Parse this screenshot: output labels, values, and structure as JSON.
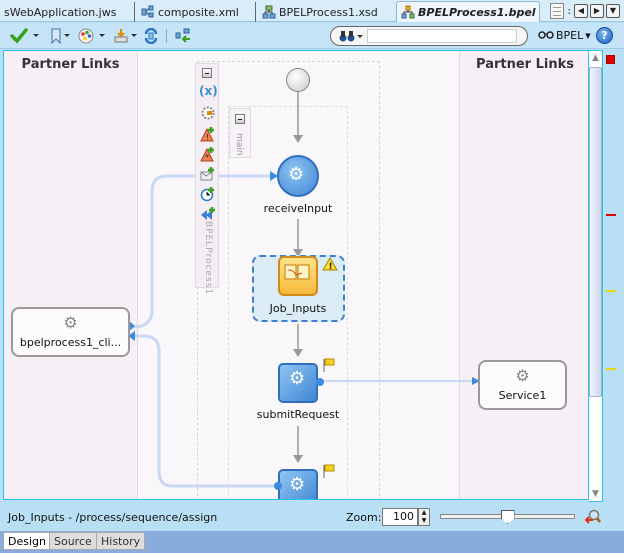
{
  "editor_tabs": [
    {
      "label": "sWebApplication.jws",
      "icon": "jws-icon",
      "active": false
    },
    {
      "label": "composite.xml",
      "icon": "composite-icon",
      "active": false
    },
    {
      "label": "BPELProcess1.xsd",
      "icon": "xsd-icon",
      "active": false
    },
    {
      "label": "BPELProcess1.bpel",
      "icon": "bpel-icon",
      "active": true
    }
  ],
  "tab_nav": {
    "list_label": "document-list",
    "prev": "◀",
    "next": "▶",
    "menu": "▼"
  },
  "toolbar": {
    "search_placeholder": "",
    "bpel_menu_label": "BPEL",
    "help_label": "?"
  },
  "canvas": {
    "left_partner_links_title": "Partner Links",
    "right_partner_links_title": "Partner Links",
    "process_scope_label": "BPELProcess1",
    "main_scope_label": "main",
    "activities": [
      {
        "name": "receiveInput",
        "type": "receive"
      },
      {
        "name": "Job_Inputs",
        "type": "assign",
        "selected": true,
        "warning": true
      },
      {
        "name": "submitRequest",
        "type": "invoke",
        "flag": true
      },
      {
        "name": "",
        "type": "invoke",
        "flag": true
      }
    ],
    "partner_links": [
      {
        "name": "bpelprocess1_cli...",
        "side": "left"
      },
      {
        "name": "Service1",
        "side": "right"
      }
    ]
  },
  "status": {
    "selection_path": "Job_Inputs - /process/sequence/assign",
    "zoom_label": "Zoom:",
    "zoom_value": "100",
    "zoom_slider_fraction": 0.5
  },
  "overview_markers": [
    {
      "color": "#e00000",
      "kind": "error"
    },
    {
      "color": "#e00000",
      "kind": "error"
    },
    {
      "color": "#e6d800",
      "kind": "warning"
    },
    {
      "color": "#e6d800",
      "kind": "warning"
    }
  ],
  "bottom_tabs": [
    {
      "label": "Design",
      "active": true
    },
    {
      "label": "Source",
      "active": false
    },
    {
      "label": "History",
      "active": false
    }
  ]
}
